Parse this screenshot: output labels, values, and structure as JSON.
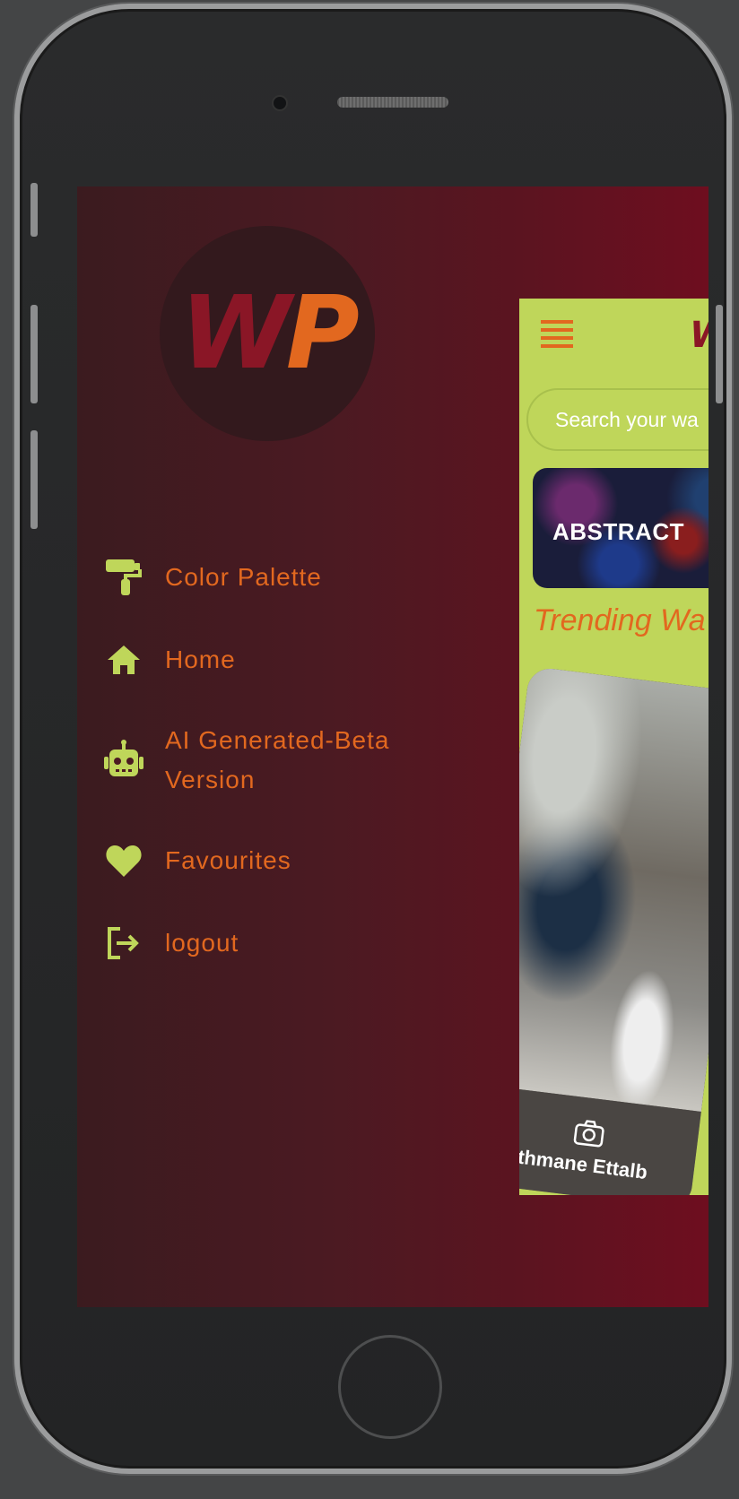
{
  "drawer": {
    "logo": {
      "letter1": "W",
      "letter2": "P",
      "color1": "#8a1626",
      "color2": "#e2681f"
    },
    "items": [
      {
        "label": "Color Palette",
        "icon": "paint-roller-icon"
      },
      {
        "label": "Home",
        "icon": "home-icon"
      },
      {
        "label": "AI Generated-Beta Version",
        "icon": "robot-icon"
      },
      {
        "label": "Favourites",
        "icon": "heart-icon"
      },
      {
        "label": "logout",
        "icon": "logout-icon"
      }
    ]
  },
  "preview": {
    "app_logo": "W",
    "search_placeholder": "Search your wa",
    "category": "ABSTRACT",
    "section_title": "Trending Wa",
    "photo_credit": "Othmane Ettalb"
  },
  "colors": {
    "accent": "#e2681f",
    "icon": "#bfd65a",
    "brand_red": "#8a1626",
    "background_dark": "#3b1b1f"
  }
}
